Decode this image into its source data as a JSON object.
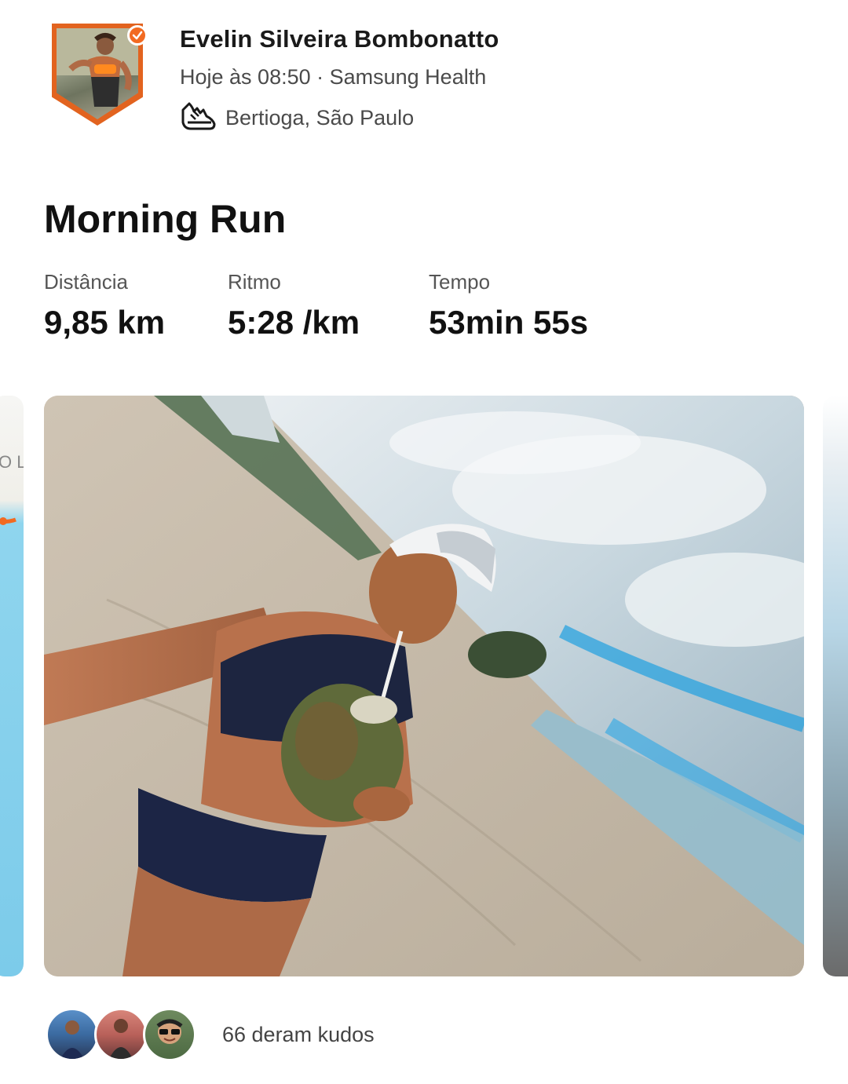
{
  "header": {
    "athlete_name": "Evelin Silveira Bombonatto",
    "meta": "Hoje às 08:50 · Samsung Health",
    "location": "Bertioga, São Paulo",
    "avatar_icon": "athlete-avatar",
    "verified_icon": "check-badge-icon",
    "activity_icon": "running-shoe-icon",
    "accent": "#f26a21"
  },
  "activity": {
    "title": "Morning Run",
    "stats": [
      {
        "label": "Distância",
        "value": "9,85 km"
      },
      {
        "label": "Ritmo",
        "value": "5:28 /km"
      },
      {
        "label": "Tempo",
        "value": "53min 55s"
      }
    ]
  },
  "media": {
    "main_photo": "beach-selfie-photo",
    "prev_item": "route-map-preview",
    "next_item": "next-photo-preview"
  },
  "kudos": {
    "text": "66 deram kudos",
    "avatar_count": 3
  }
}
